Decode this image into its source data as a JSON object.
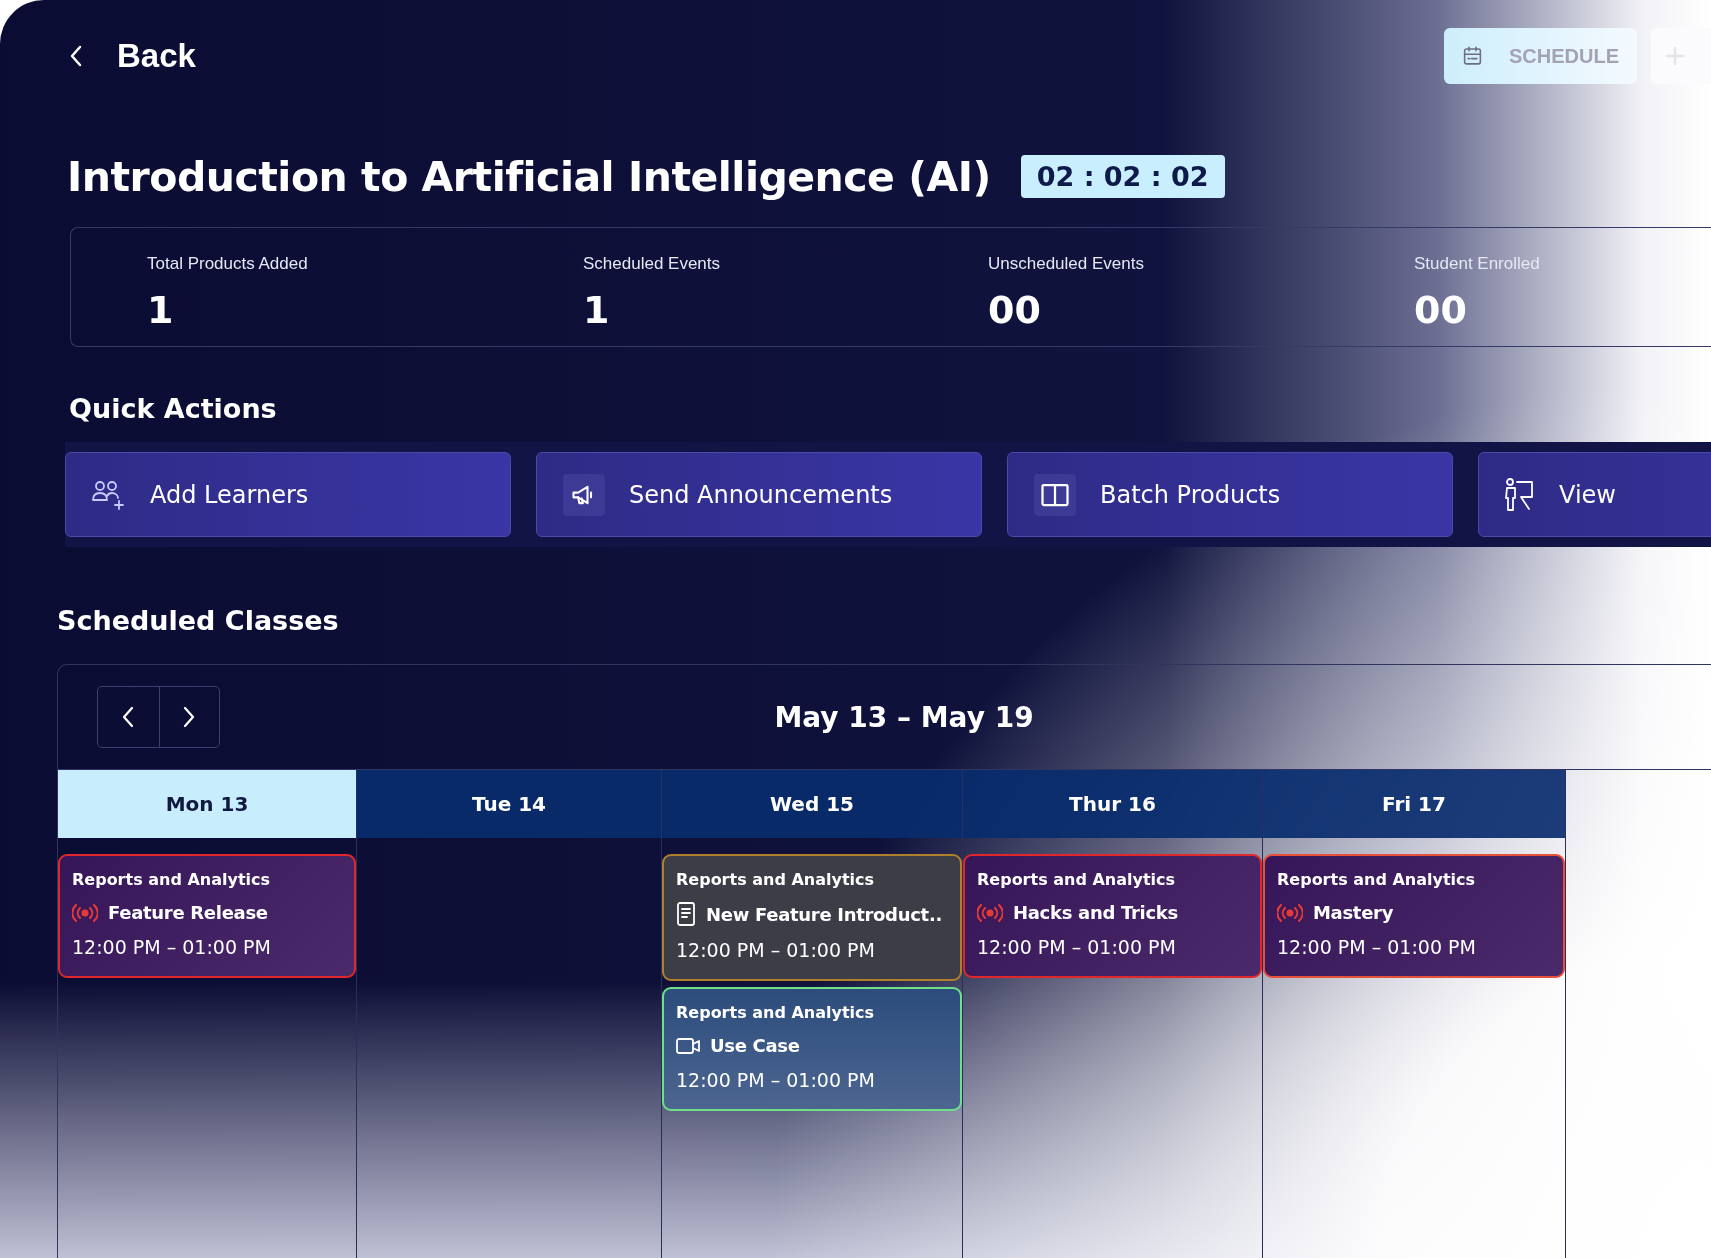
{
  "back": {
    "label": "Back"
  },
  "header_actions": [
    {
      "kind": "schedule",
      "label": "SCHEDULE"
    },
    {
      "kind": "add"
    }
  ],
  "title": "Introduction to Artificial Intelligence (AI)",
  "timer": "02 : 02 : 02",
  "stats": [
    {
      "label": "Total Products Added",
      "value": "1"
    },
    {
      "label": "Scheduled Events",
      "value": "1"
    },
    {
      "label": "Unscheduled Events",
      "value": "00"
    },
    {
      "label": "Student Enrolled",
      "value": "00"
    }
  ],
  "quick_actions": {
    "title": "Quick Actions",
    "items": [
      {
        "kind": "learners",
        "label": "Add Learners"
      },
      {
        "kind": "announce",
        "label": "Send Announcements"
      },
      {
        "kind": "book",
        "label": "Batch Products"
      },
      {
        "kind": "teacher",
        "label": "View"
      }
    ]
  },
  "schedule": {
    "title": "Scheduled Classes",
    "range": "May 13 – May 19",
    "days": [
      {
        "label": "Mon 13",
        "selected": true,
        "events": [
          {
            "category": "Reports and Analytics",
            "kind": "live",
            "title": "Feature Release",
            "time": "12:00 PM – 01:00 PM",
            "color": "#e0282c"
          }
        ]
      },
      {
        "label": "Tue 14",
        "selected": false
      },
      {
        "label": "Wed 15",
        "selected": false,
        "events": [
          {
            "category": "Reports and Analytics",
            "kind": "document",
            "title": "New Feature Introduct..",
            "time": "12:00 PM – 01:00 PM",
            "color": "#b0802a"
          },
          {
            "category": "Reports and Analytics",
            "kind": "video",
            "title": "Use Case",
            "time": "12:00 PM – 01:00 PM",
            "color": "#6ee08a"
          }
        ]
      },
      {
        "label": "Thur 16",
        "selected": false,
        "events": [
          {
            "category": "Reports and Analytics",
            "kind": "live",
            "title": "Hacks and Tricks",
            "time": "12:00 PM – 01:00 PM",
            "color": "#e0282c"
          }
        ]
      },
      {
        "label": "Fri 17",
        "selected": false,
        "events": [
          {
            "category": "Reports and Analytics",
            "kind": "live",
            "title": "Mastery",
            "time": "12:00 PM – 01:00 PM",
            "color": "#e8503a"
          }
        ]
      }
    ]
  }
}
